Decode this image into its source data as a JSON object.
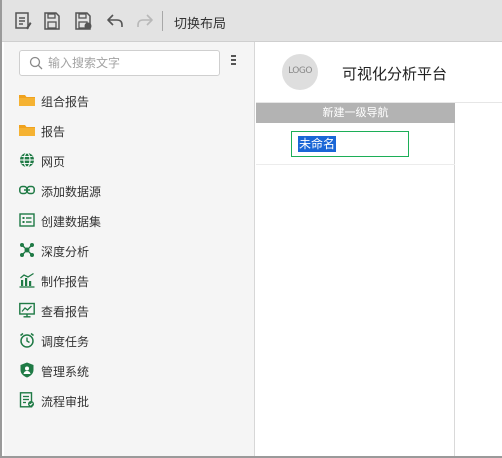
{
  "toolbar": {
    "icons": [
      "edit-file-icon",
      "save-icon",
      "save-as-icon",
      "undo-icon",
      "redo-icon"
    ],
    "switch_layout_label": "切换布局"
  },
  "sidebar": {
    "search": {
      "placeholder": "输入搜索文字",
      "value": ""
    },
    "items": [
      {
        "label": "组合报告",
        "icon": "folder-icon",
        "color": "#f0a21e"
      },
      {
        "label": "报告",
        "icon": "folder-icon",
        "color": "#f0a21e"
      },
      {
        "label": "网页",
        "icon": "globe-icon",
        "color": "#1f7a45"
      },
      {
        "label": "添加数据源",
        "icon": "link-icon",
        "color": "#1f7a45"
      },
      {
        "label": "创建数据集",
        "icon": "dataset-icon",
        "color": "#1f7a45"
      },
      {
        "label": "深度分析",
        "icon": "network-icon",
        "color": "#1f7a45"
      },
      {
        "label": "制作报告",
        "icon": "bar-chart-icon",
        "color": "#1f7a45"
      },
      {
        "label": "查看报告",
        "icon": "line-chart-icon",
        "color": "#1f7a45"
      },
      {
        "label": "调度任务",
        "icon": "alarm-clock-icon",
        "color": "#1f7a45"
      },
      {
        "label": "管理系统",
        "icon": "shield-user-icon",
        "color": "#1f7a45"
      },
      {
        "label": "流程审批",
        "icon": "approval-doc-icon",
        "color": "#1f7a45"
      }
    ]
  },
  "main": {
    "logo_text": "LOGO",
    "platform_title": "可视化分析平台",
    "nav_panel": {
      "header": "新建一级导航",
      "name_value": "未命名"
    }
  },
  "colors": {
    "accent_green": "#1f7a45",
    "folder": "#f0a21e",
    "focus_border": "#1cae57",
    "selection": "#1a66d6"
  }
}
